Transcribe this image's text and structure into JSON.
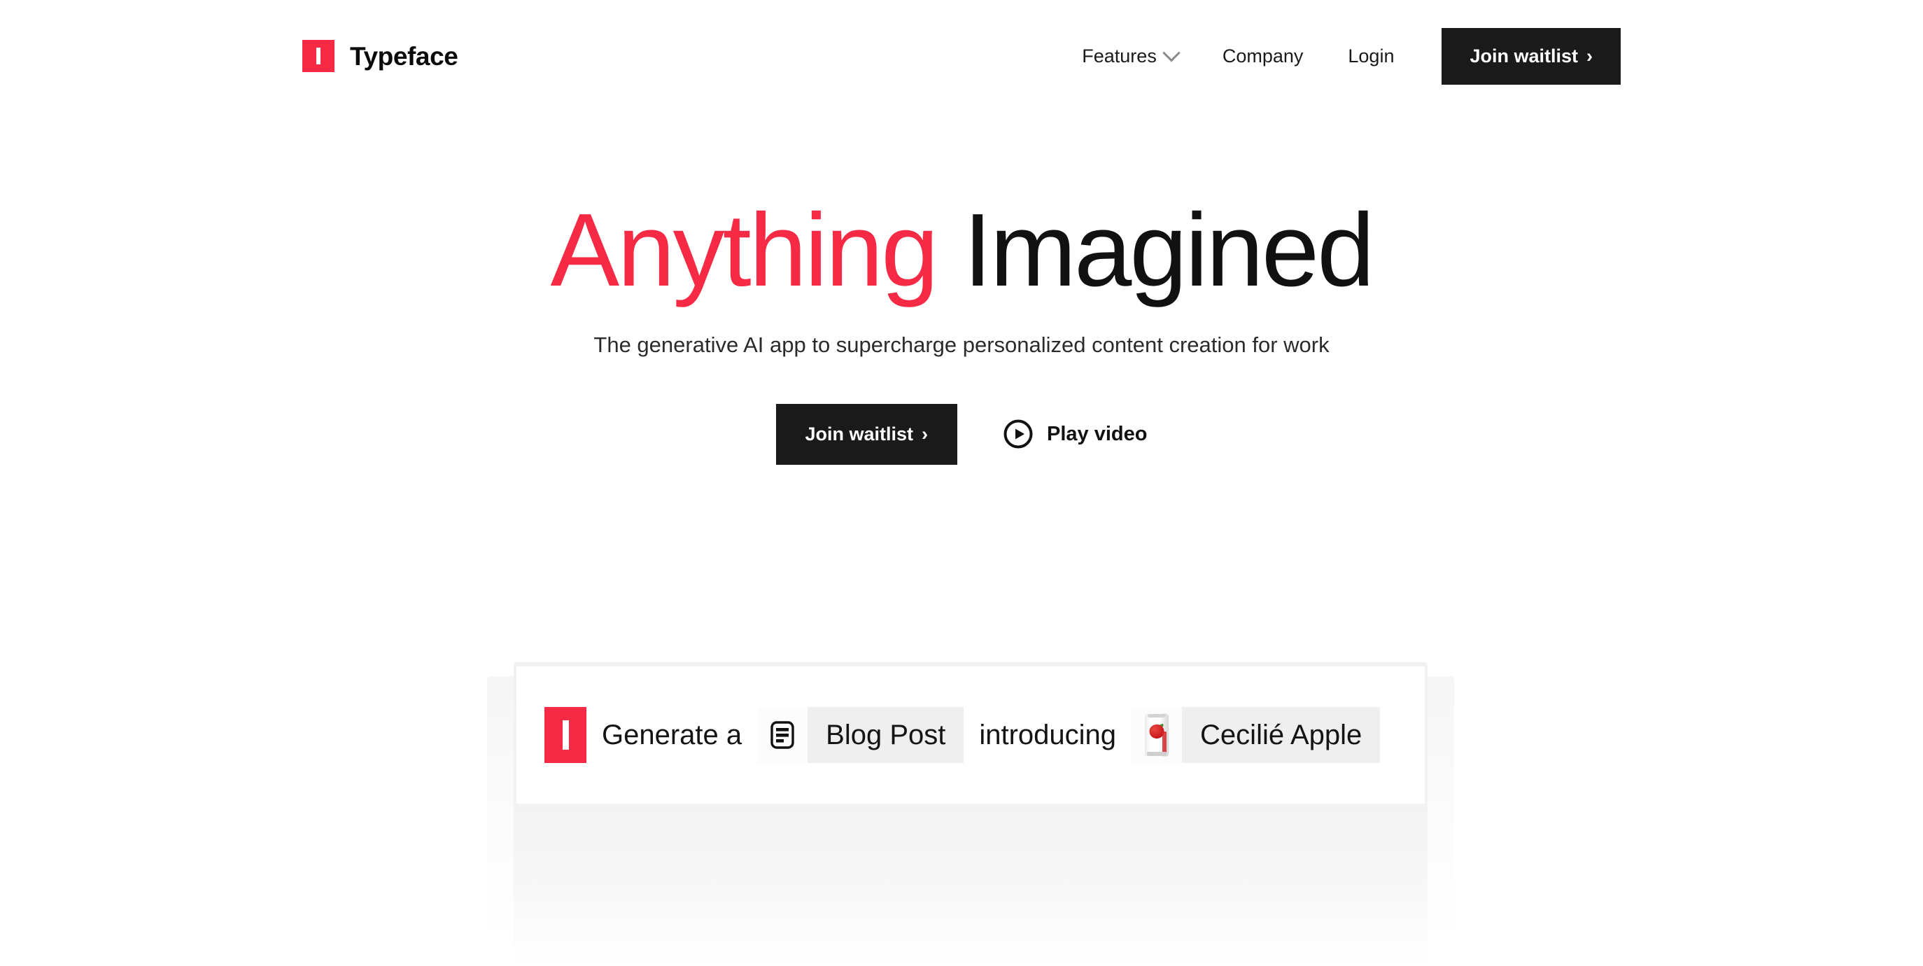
{
  "brand": {
    "name": "Typeface",
    "mark_color": "#F62A44",
    "mark_glyph": "I"
  },
  "header": {
    "nav": [
      {
        "label": "Features",
        "has_dropdown": true
      },
      {
        "label": "Company",
        "has_dropdown": false
      },
      {
        "label": "Login",
        "has_dropdown": false
      }
    ],
    "cta": {
      "label": "Join waitlist",
      "chevron": "›",
      "bg": "#1A1A1A"
    }
  },
  "hero": {
    "title_accent": "Anything",
    "title_rest": " Imagined",
    "accent_color": "#F62A44",
    "subtitle": "The generative AI app to supercharge personalized content creation for work",
    "primary_cta": {
      "label": "Join waitlist",
      "chevron": "›"
    },
    "video_link": {
      "label": "Play video",
      "icon": "play-circle-icon"
    }
  },
  "preview": {
    "logo_glyph": "I",
    "segments": {
      "lead_text": "Generate a",
      "chip_one": {
        "icon": "document-icon",
        "label": "Blog Post"
      },
      "middle_text": "introducing",
      "chip_two": {
        "icon": "product-can-thumbnail",
        "label": "Cecilié Apple"
      }
    }
  }
}
